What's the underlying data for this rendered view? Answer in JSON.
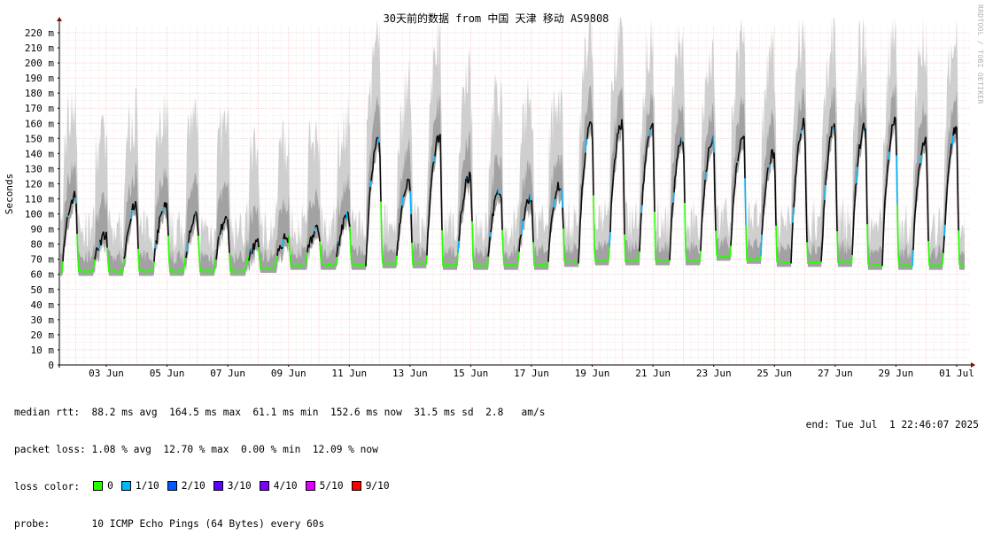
{
  "title": "30天前的数据 from 中国 天津 移动 AS9808",
  "watermark": "RRDTOOL / TOBI OETIKER",
  "chart_data": {
    "type": "area",
    "title": "30天前的数据 from 中国 天津 移动 AS9808",
    "ylabel": "Seconds",
    "ylim": [
      0,
      230
    ],
    "y_tick_labels": [
      "0",
      "10 m",
      "20 m",
      "30 m",
      "40 m",
      "50 m",
      "60 m",
      "70 m",
      "80 m",
      "90 m",
      "100 m",
      "110 m",
      "120 m",
      "130 m",
      "140 m",
      "150 m",
      "160 m",
      "170 m",
      "180 m",
      "190 m",
      "200 m",
      "210 m",
      "220 m"
    ],
    "x_tick_labels": [
      "03 Jun",
      "05 Jun",
      "07 Jun",
      "09 Jun",
      "11 Jun",
      "13 Jun",
      "15 Jun",
      "17 Jun",
      "19 Jun",
      "21 Jun",
      "23 Jun",
      "25 Jun",
      "27 Jun",
      "29 Jun",
      "01 Jul"
    ],
    "grid": true,
    "series": [
      {
        "name": "median rtt",
        "days": [
          "01 Jun",
          "02 Jun",
          "03 Jun",
          "04 Jun",
          "05 Jun",
          "06 Jun",
          "07 Jun",
          "08 Jun",
          "09 Jun",
          "10 Jun",
          "11 Jun",
          "12 Jun",
          "13 Jun",
          "14 Jun",
          "15 Jun",
          "16 Jun",
          "17 Jun",
          "18 Jun",
          "19 Jun",
          "20 Jun",
          "21 Jun",
          "22 Jun",
          "23 Jun",
          "24 Jun",
          "25 Jun",
          "26 Jun",
          "27 Jun",
          "28 Jun",
          "29 Jun",
          "30 Jun",
          "01 Jul"
        ],
        "baseline_ms": [
          62,
          62,
          62,
          62,
          62,
          62,
          62,
          64,
          66,
          66,
          66,
          67,
          67,
          66,
          66,
          66,
          66,
          68,
          69,
          69,
          69,
          69,
          72,
          70,
          68,
          68,
          68,
          66,
          66,
          66,
          66
        ],
        "evening_peak_ms": [
          112,
          85,
          105,
          105,
          98,
          95,
          80,
          85,
          90,
          98,
          150,
          120,
          150,
          125,
          115,
          110,
          120,
          160,
          160,
          158,
          150,
          150,
          150,
          140,
          160,
          158,
          158,
          162,
          150,
          155,
          150
        ]
      }
    ],
    "loss_colors": {
      "0": "#26ff00",
      "1/10": "#00b8ff",
      "2/10": "#0059ff",
      "3/10": "#5e00ff",
      "4/10": "#7e00ff",
      "5/10": "#dd00ff",
      "9/10": "#ff0000"
    }
  },
  "stats": {
    "median_rtt": "median rtt:  88.2 ms avg  164.5 ms max  61.1 ms min  152.6 ms now  31.5 ms sd  2.8   am/s",
    "packet_loss": "packet loss: 1.08 % avg  12.70 % max  0.00 % min  12.09 % now",
    "loss_color_label": "loss color:",
    "probe": "probe:       10 ICMP Echo Pings (64 Bytes) every 60s",
    "end": "end: Tue Jul  1 22:46:07 2025"
  },
  "loss_items": [
    {
      "label": "0",
      "color": "#26ff00"
    },
    {
      "label": "1/10",
      "color": "#00b8ff"
    },
    {
      "label": "2/10",
      "color": "#0059ff"
    },
    {
      "label": "3/10",
      "color": "#5e00ff"
    },
    {
      "label": "4/10",
      "color": "#7e00ff"
    },
    {
      "label": "5/10",
      "color": "#dd00ff"
    },
    {
      "label": "9/10",
      "color": "#ff0000"
    }
  ]
}
